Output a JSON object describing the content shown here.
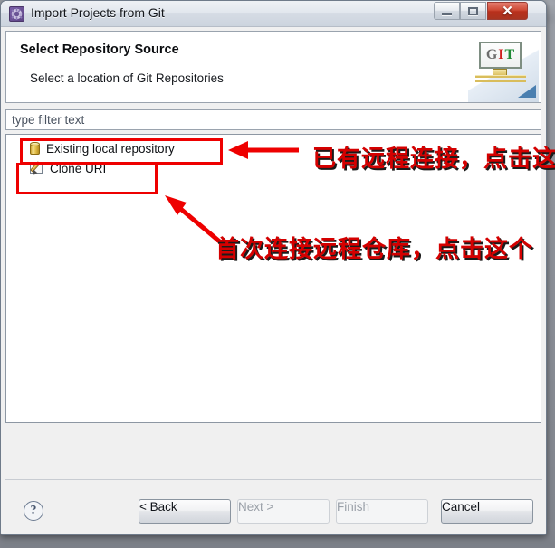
{
  "window": {
    "title": "Import Projects from Git",
    "icon": "gear-purple-icon",
    "controls": {
      "minimize": "minimize-icon",
      "maximize": "maximize-icon",
      "close": "✕"
    }
  },
  "header": {
    "title": "Select Repository Source",
    "subtitle": "Select a location of Git Repositories",
    "banner": {
      "icon": "git-banner-icon",
      "letters": [
        "G",
        "I",
        "T"
      ],
      "letter_colors": [
        "#6d6d6d",
        "#cf2020",
        "#1f8a36"
      ]
    }
  },
  "filter": {
    "value": "",
    "placeholder": "type filter text"
  },
  "source_list": {
    "items": [
      {
        "label": "Existing local repository",
        "icon": "repository-cylinder-icon"
      },
      {
        "label": "Clone URI",
        "icon": "clone-uri-pencil-icon"
      }
    ]
  },
  "footer": {
    "help": "?",
    "buttons": [
      {
        "label": "< Back",
        "enabled": true
      },
      {
        "label": "Next >",
        "enabled": false
      },
      {
        "label": "Finish",
        "enabled": false
      },
      {
        "label": "Cancel",
        "enabled": true
      }
    ]
  },
  "annotations": {
    "color": "#d40000",
    "boxes": [
      {
        "target": "Existing local repository"
      },
      {
        "target": "Clone URI"
      }
    ],
    "arrows": [
      {
        "direction": "left",
        "points_to": "Existing local repository"
      },
      {
        "direction": "up-left",
        "points_to": "Clone URI"
      }
    ],
    "texts": [
      "已有远程连接，点击这个",
      "首次连接远程仓库，点击这个"
    ]
  }
}
